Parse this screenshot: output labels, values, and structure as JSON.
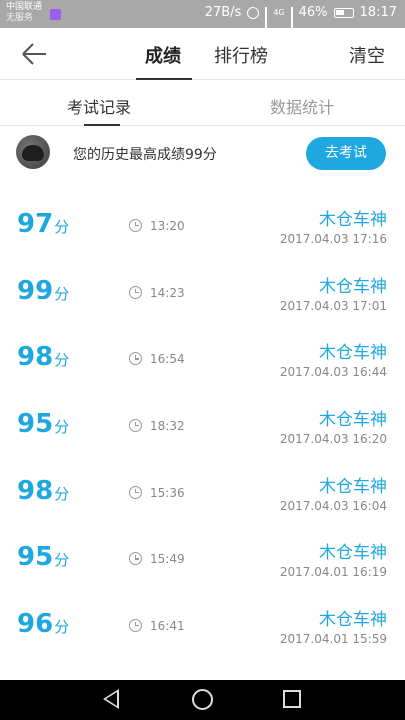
{
  "status_bar": {
    "carrier_line1": "中国联通",
    "carrier_line2": "无服务",
    "speed": "27B/s",
    "network": "4G",
    "battery": "46%",
    "time": "18:17"
  },
  "header": {
    "tabs": [
      {
        "label": "成绩",
        "active": true
      },
      {
        "label": "排行榜",
        "active": false
      }
    ],
    "clear_label": "清空"
  },
  "subtabs": [
    {
      "label": "考试记录",
      "active": true
    },
    {
      "label": "数据统计",
      "active": false
    }
  ],
  "best": {
    "text": "您的历史最高成绩99分",
    "button_label": "去考试"
  },
  "records": [
    {
      "score": "97",
      "unit": "分",
      "duration": "13:20",
      "name": "木仓车神",
      "date": "2017.04.03  17:16"
    },
    {
      "score": "99",
      "unit": "分",
      "duration": "14:23",
      "name": "木仓车神",
      "date": "2017.04.03  17:01"
    },
    {
      "score": "98",
      "unit": "分",
      "duration": "16:54",
      "name": "木仓车神",
      "date": "2017.04.03  16:44"
    },
    {
      "score": "95",
      "unit": "分",
      "duration": "18:32",
      "name": "木仓车神",
      "date": "2017.04.03  16:20"
    },
    {
      "score": "98",
      "unit": "分",
      "duration": "15:36",
      "name": "木仓车神",
      "date": "2017.04.03  16:04"
    },
    {
      "score": "95",
      "unit": "分",
      "duration": "15:49",
      "name": "木仓车神",
      "date": "2017.04.01  16:19"
    },
    {
      "score": "96",
      "unit": "分",
      "duration": "16:41",
      "name": "木仓车神",
      "date": "2017.04.01  15:59"
    }
  ],
  "colors": {
    "accent": "#1fa8e0",
    "status_bar": "#a8a8a8",
    "nav_bar": "#000000"
  },
  "icons": {
    "back": "arrow-left-icon",
    "clock": "clock-icon",
    "nav_back": "triangle-back-icon",
    "nav_home": "circle-home-icon",
    "nav_recent": "square-recent-icon"
  }
}
